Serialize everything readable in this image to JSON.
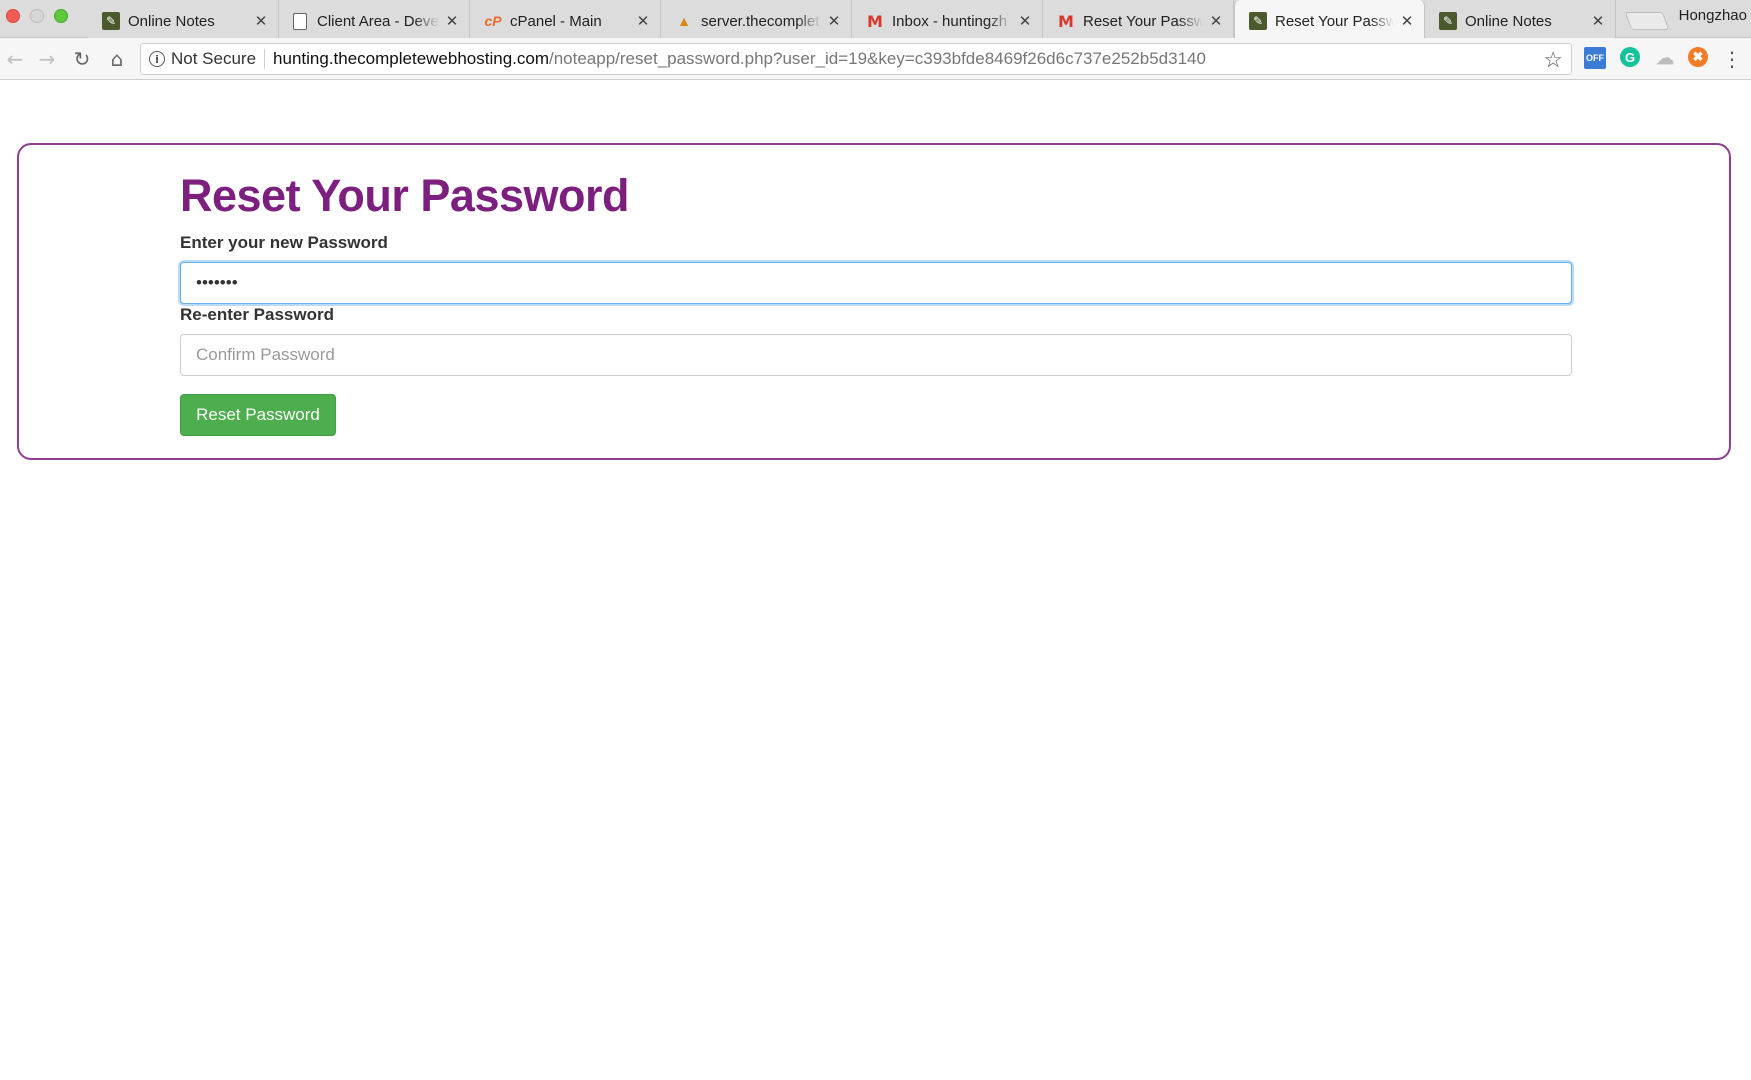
{
  "browser": {
    "tabs": [
      {
        "title": "Online Notes",
        "favicon": "note-icon",
        "active": false
      },
      {
        "title": "Client Area - Deve",
        "favicon": "document-icon",
        "active": false
      },
      {
        "title": "cPanel - Main",
        "favicon": "cpanel-icon",
        "active": false
      },
      {
        "title": "server.thecomplet",
        "favicon": "server-icon",
        "active": false
      },
      {
        "title": "Inbox - huntingzh",
        "favicon": "gmail-icon",
        "active": false
      },
      {
        "title": "Reset Your Passw",
        "favicon": "gmail-icon",
        "active": false
      },
      {
        "title": "Reset Your Passw",
        "favicon": "note-icon",
        "active": true
      },
      {
        "title": "Online Notes",
        "favicon": "note-icon",
        "active": false
      }
    ],
    "profile_name": "Hongzhao",
    "security_label": "Not Secure",
    "url_host": "hunting.thecompletewebhosting.com",
    "url_path": "/noteapp/reset_password.php?user_id=19&key=c393bfde8469f26d6c737e252b5d3140",
    "extension_off_label": "OFF",
    "extension_g_label": "G"
  },
  "page": {
    "title": "Reset Your Password",
    "new_password_label": "Enter your new Password",
    "new_password_value": "•••••••",
    "confirm_label": "Re-enter Password",
    "confirm_placeholder": "Confirm Password",
    "confirm_value": "",
    "submit_label": "Reset Password"
  },
  "colors": {
    "title": "#7c1f7e",
    "card_border": "#8d3f8e",
    "button": "#4cae4c",
    "focus_ring": "#66afe9"
  }
}
